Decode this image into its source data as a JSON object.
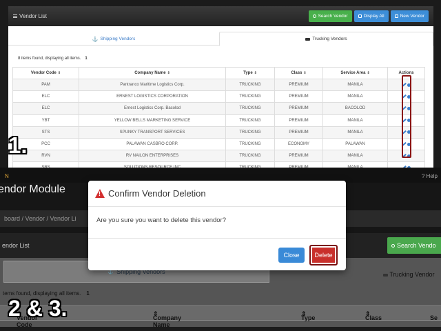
{
  "top": {
    "title": "Vendor List",
    "buttons": {
      "search": "Search Vendor",
      "display_all": "Display All",
      "new": "New Vendor"
    },
    "tabs": {
      "shipping": "Shipping Vendors",
      "trucking": "Trucking Vendors"
    },
    "found_text": "8 items found, displaying all items.",
    "page_number": "1",
    "columns": [
      "Vendor Code",
      "Company Name",
      "Type",
      "Class",
      "Service Area",
      "Actions"
    ],
    "rows": [
      [
        "PAM",
        "Pantranco Maritime Logistics Corp.",
        "TRUCKING",
        "PREMIUM",
        "MANILA"
      ],
      [
        "ELC",
        "ERNEST LOGISTICS CORPORATION",
        "TRUCKING",
        "PREMIUM",
        "MANILA"
      ],
      [
        "ELC",
        "Ernest Logistics Corp. Bacolod",
        "TRUCKING",
        "PREMIUM",
        "BACOLOD"
      ],
      [
        "YBT",
        "YELLOW BELLS MARKETING SERVICE",
        "TRUCKING",
        "PREMIUM",
        "MANILA"
      ],
      [
        "STS",
        "SPUNKY TRANSPORT SERVICES",
        "TRUCKING",
        "PREMIUM",
        "MANILA"
      ],
      [
        "PCC",
        "PALAWAN CASBRO CORP.",
        "TRUCKING",
        "ECONOMY",
        "PALAWAN"
      ],
      [
        "RVN",
        "RV NAILON ENTERPRISES",
        "TRUCKING",
        "PREMIUM",
        "MANILA"
      ],
      [
        "SRS",
        "SOLUTIONS RESOURCE INC",
        "TRUCKING",
        "PREMIUM",
        "MANILA"
      ]
    ],
    "step_label": "1."
  },
  "bottom": {
    "brand": "N",
    "help": "Help",
    "module_title": "endor Module",
    "breadcrumb": "board  /  Vendor  /  Vendor Li",
    "list_title": "endor List",
    "search_btn": "Search Vendo",
    "shipping_tab": "Shipping Vendors",
    "trucking_tab": "Trucking Vendor",
    "found_text": "tems found, displaying all items.",
    "page_number": "1",
    "columns": [
      "Vendor Code",
      "Company Name",
      "Type",
      "Class",
      "Se"
    ],
    "step_label": "2 & 3."
  },
  "modal": {
    "title": "Confirm Vendor Deletion",
    "message": "Are you sure you want to delete this vendor?",
    "close_label": "Close",
    "delete_label": "Delete"
  },
  "colors": {
    "accent_blue": "#3a8ad7",
    "green": "#48b04b",
    "danger": "#c9302c",
    "highlight": "#8a1414"
  }
}
